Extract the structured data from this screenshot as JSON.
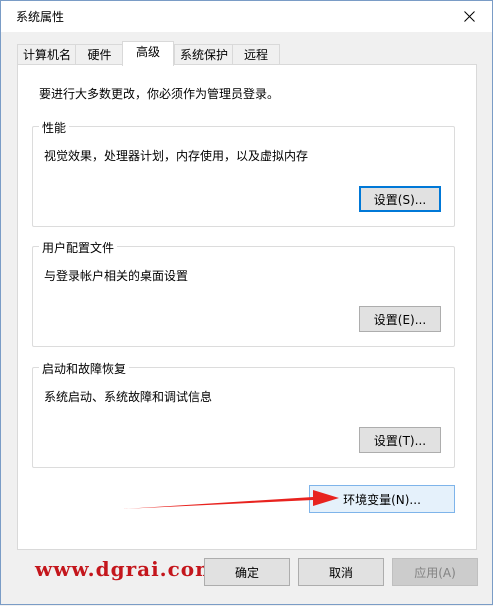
{
  "window": {
    "title": "系统属性"
  },
  "tabs": [
    {
      "label": "计算机名"
    },
    {
      "label": "硬件"
    },
    {
      "label": "高级"
    },
    {
      "label": "系统保护"
    },
    {
      "label": "远程"
    }
  ],
  "panel": {
    "notice": "要进行大多数更改，你必须作为管理员登录。",
    "performance": {
      "title": "性能",
      "desc": "视觉效果，处理器计划，内存使用，以及虚拟内存",
      "button": "设置(S)..."
    },
    "profiles": {
      "title": "用户配置文件",
      "desc": "与登录帐户相关的桌面设置",
      "button": "设置(E)..."
    },
    "startup": {
      "title": "启动和故障恢复",
      "desc": "系统启动、系统故障和调试信息",
      "button": "设置(T)..."
    },
    "env_button": "环境变量(N)..."
  },
  "footer": {
    "ok": "确定",
    "cancel": "取消",
    "apply": "应用(A)"
  },
  "watermark": "www.dgrai.com",
  "colors": {
    "accent": "#0078d7",
    "arrow": "#e8231f",
    "watermark": "#c4161c"
  }
}
